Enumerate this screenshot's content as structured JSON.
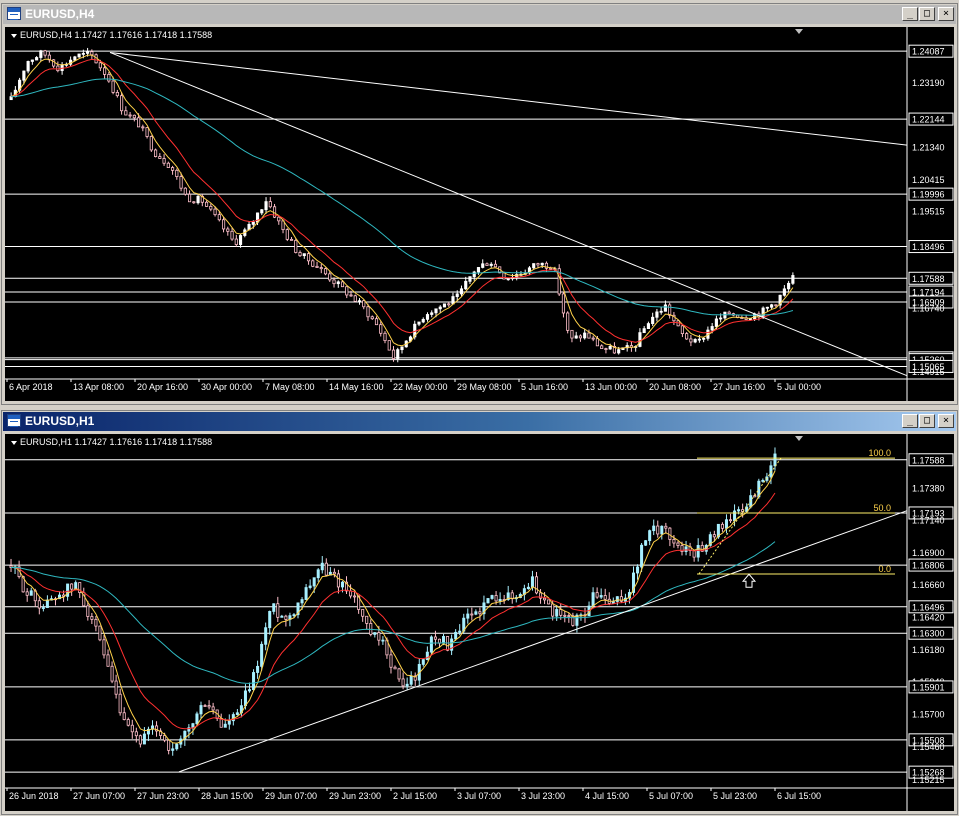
{
  "colors": {
    "background": "#000000",
    "grid_line": "#ffffff",
    "bull_candle": "#ffffff",
    "bear_candle": "#ffc0cb",
    "h1_bull_candle": "#a8f0ff",
    "ma_fast": "#ffd24a",
    "ma_mid": "#ff3030",
    "ma_slow": "#2fb8c0",
    "fib": "#fff06a",
    "fib_level_color": "#ffd24a"
  },
  "windows": [
    {
      "title": "EURUSD,H4",
      "active": false,
      "buttons": [
        "_",
        "□",
        "×"
      ],
      "info": "EURUSD,H4  1.17427 1.17616 1.17418 1.17588",
      "chart_data": {
        "type": "candlestick",
        "symbol": "EURUSD",
        "timeframe": "H4",
        "ohlc_last": {
          "open": 1.17427,
          "high": 1.17616,
          "low": 1.17418,
          "close": 1.17588
        },
        "ylim": [
          1.1482,
          1.2455
        ],
        "price_ticks": [
          "1.24087",
          "1.23190",
          "1.22144",
          "1.21340",
          "1.20415",
          "1.19996",
          "1.19515",
          "1.18496",
          "1.17588",
          "1.17194",
          "1.16909",
          "1.16740",
          "1.15311",
          "1.15260",
          "1.15065",
          "1.14915"
        ],
        "boxed_ticks": [
          "1.24087",
          "1.22144",
          "1.19996",
          "1.18496",
          "1.17588",
          "1.17194",
          "1.16909",
          "1.15311",
          "1.15260",
          "1.15065"
        ],
        "horizontal_levels": [
          1.24087,
          1.22144,
          1.19996,
          1.18496,
          1.17588,
          1.17194,
          1.16909,
          1.15311,
          1.1526,
          1.15065
        ],
        "time_labels": [
          "6 Apr 2018",
          "13 Apr 08:00",
          "20 Apr 16:00",
          "30 Apr 00:00",
          "7 May 08:00",
          "14 May 16:00",
          "22 May 00:00",
          "29 May 08:00",
          "5 Jun 16:00",
          "13 Jun 00:00",
          "20 Jun 08:00",
          "27 Jun 16:00",
          "5 Jul 00:00"
        ],
        "price_path": [
          1.227,
          1.238,
          1.2405,
          1.236,
          1.2395,
          1.24,
          1.234,
          1.224,
          1.22,
          1.212,
          1.208,
          1.199,
          1.198,
          1.192,
          1.186,
          1.191,
          1.1985,
          1.19,
          1.183,
          1.18,
          1.176,
          1.172,
          1.168,
          1.162,
          1.153,
          1.16,
          1.166,
          1.168,
          1.1705,
          1.178,
          1.181,
          1.176,
          1.1775,
          1.18,
          1.1795,
          1.158,
          1.16,
          1.156,
          1.155,
          1.156,
          1.164,
          1.168,
          1.16,
          1.157,
          1.163,
          1.166,
          1.165,
          1.166,
          1.1695,
          1.1759
        ],
        "trendlines": [
          {
            "from_price": 1.2405,
            "to_price": 1.214,
            "note": "long descending line"
          },
          {
            "from_price": 1.2405,
            "to_price": 1.148,
            "note": "steep descending line"
          }
        ]
      }
    },
    {
      "title": "EURUSD,H1",
      "active": true,
      "buttons": [
        "_",
        "□",
        "×"
      ],
      "info": "EURUSD,H1  1.17427 1.17616 1.17418 1.17588",
      "fib_levels": [
        {
          "label": "100.0",
          "price": 1.176
        },
        {
          "label": "50.0",
          "price": 1.17193
        },
        {
          "label": "0.0",
          "price": 1.1674
        }
      ],
      "chart_data": {
        "type": "candlestick",
        "symbol": "EURUSD",
        "timeframe": "H1",
        "ohlc_last": {
          "open": 1.17427,
          "high": 1.17616,
          "low": 1.17418,
          "close": 1.17588
        },
        "ylim": [
          1.1518,
          1.1772
        ],
        "price_ticks": [
          "1.17588",
          "1.17380",
          "1.17193",
          "1.17140",
          "1.16900",
          "1.16806",
          "1.16660",
          "1.16496",
          "1.16420",
          "1.16300",
          "1.16180",
          "1.15940",
          "1.15901",
          "1.15700",
          "1.15508",
          "1.15460",
          "1.15268",
          "1.15215"
        ],
        "boxed_ticks": [
          "1.17588",
          "1.17193",
          "1.16806",
          "1.16496",
          "1.16300",
          "1.15901",
          "1.15508",
          "1.15268"
        ],
        "horizontal_levels": [
          1.17588,
          1.17193,
          1.16806,
          1.16496,
          1.163,
          1.15901,
          1.15508,
          1.15268
        ],
        "time_labels": [
          "26 Jun 2018",
          "27 Jun 07:00",
          "27 Jun 23:00",
          "28 Jun 15:00",
          "29 Jun 07:00",
          "29 Jun 23:00",
          "2 Jul 15:00",
          "3 Jul 07:00",
          "3 Jul 23:00",
          "4 Jul 15:00",
          "5 Jul 07:00",
          "5 Jul 23:00",
          "6 Jul 15:00"
        ],
        "price_path": [
          1.168,
          1.166,
          1.165,
          1.166,
          1.1665,
          1.164,
          1.16,
          1.156,
          1.155,
          1.156,
          1.154,
          1.156,
          1.158,
          1.156,
          1.157,
          1.16,
          1.165,
          1.164,
          1.166,
          1.168,
          1.167,
          1.166,
          1.163,
          1.162,
          1.159,
          1.16,
          1.163,
          1.162,
          1.164,
          1.165,
          1.166,
          1.1655,
          1.167,
          1.165,
          1.164,
          1.164,
          1.166,
          1.165,
          1.166,
          1.17,
          1.171,
          1.1695,
          1.169,
          1.17,
          1.1715,
          1.172,
          1.174,
          1.1759
        ],
        "trendlines": [
          {
            "from_price": 1.1527,
            "to_price": 1.1721,
            "note": "ascending support line"
          },
          {
            "from_price": 1.1674,
            "to_price": 1.176,
            "note": "dotted fib baseline"
          }
        ]
      }
    }
  ]
}
